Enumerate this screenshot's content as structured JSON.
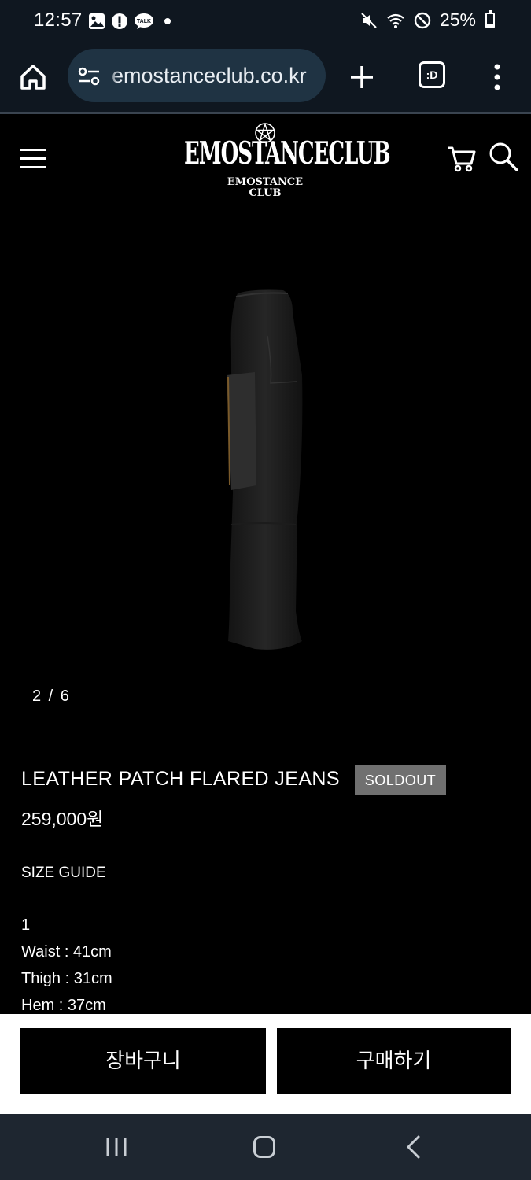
{
  "status_bar": {
    "time": "12:57",
    "battery_percent": "25%",
    "battery_level": 0.25,
    "left_icons": [
      "gallery-icon",
      "alert-icon",
      "kakaotalk-icon",
      "dot"
    ],
    "kakaotalk_label": "TALK",
    "right_icons": [
      "mute-icon",
      "wifi-icon",
      "do-not-disturb-icon",
      "battery-icon"
    ]
  },
  "browser": {
    "url": "emostanceclub.co.kr",
    "tab_label": ":D"
  },
  "site": {
    "logo_main": "EMOSTANCECLUB",
    "logo_sub_1": "EMOSTANCE",
    "logo_sub_2": "CLUB"
  },
  "gallery": {
    "pager": "2 / 6"
  },
  "product": {
    "name": "LEATHER PATCH FLARED JEANS",
    "badge": "SOLDOUT",
    "price": "259,000원",
    "size_guide_label": "SIZE GUIDE",
    "specs": [
      "1",
      "Waist : 41cm",
      "Thigh : 31cm",
      "Hem : 37cm"
    ]
  },
  "actions": {
    "cart_label": "장바구니",
    "buy_label": "구매하기"
  },
  "colors": {
    "system_bar": "#0f1720",
    "url_bar": "#1f3343",
    "badge": "#707070",
    "background": "#000000",
    "action_bar": "#ffffff"
  }
}
